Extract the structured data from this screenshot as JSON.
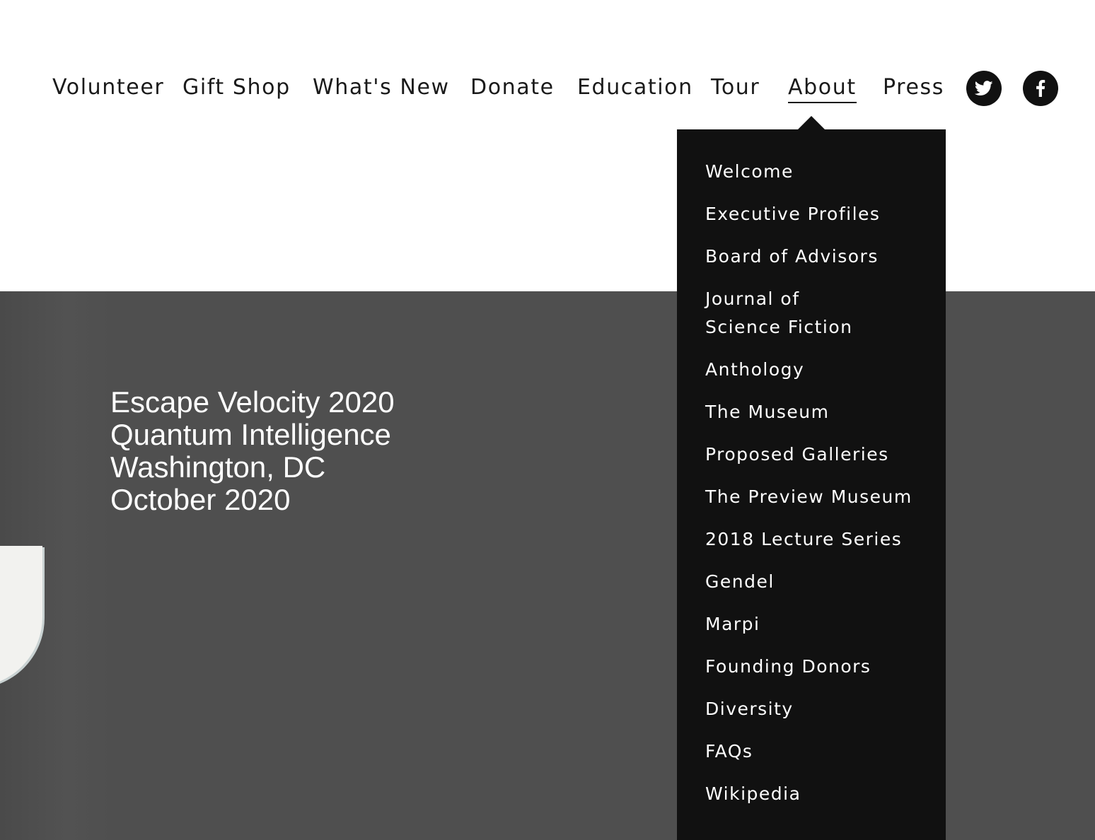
{
  "nav": {
    "items": [
      {
        "label": "Volunteer"
      },
      {
        "label": "Gift Shop"
      },
      {
        "label": "What's New"
      },
      {
        "label": "Donate"
      },
      {
        "label": "Education"
      },
      {
        "label": "Tour"
      },
      {
        "label": "About",
        "active": true
      },
      {
        "label": "Press"
      }
    ],
    "social": [
      {
        "icon": "twitter-icon"
      },
      {
        "icon": "facebook-icon"
      }
    ]
  },
  "dropdown": {
    "parent": "About",
    "items": [
      "Welcome",
      "Executive Profiles",
      "Board of Advisors",
      "Journal of Science Fiction",
      "Anthology",
      "The Museum",
      "Proposed Galleries",
      "The Preview Museum",
      "2018 Lecture Series",
      "Gendel",
      "Marpi",
      "Founding Donors",
      "Diversity",
      "FAQs",
      "Wikipedia"
    ]
  },
  "hero": {
    "lines": [
      "Escape Velocity 2020",
      "Quantum Intelligence",
      "Washington, DC",
      "October 2020"
    ]
  },
  "colors": {
    "nav_text": "#1a1a1a",
    "dropdown_bg": "#111111",
    "hero_bg": "#4f4f4f",
    "hero_text": "#ffffff"
  }
}
